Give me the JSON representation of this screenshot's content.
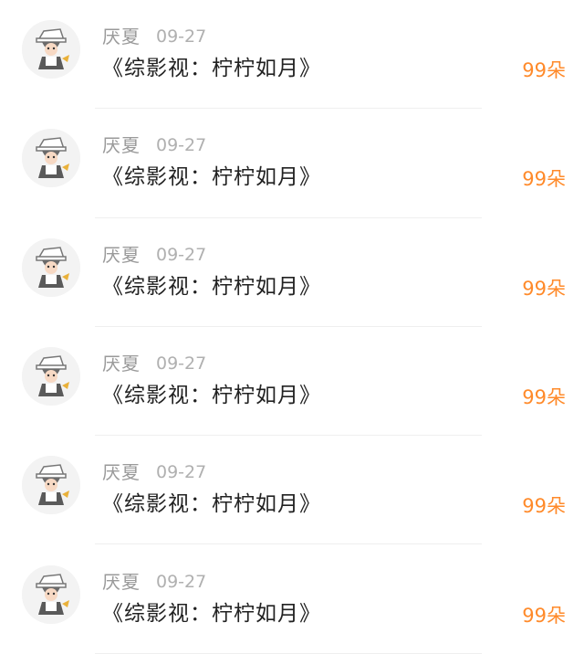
{
  "items": [
    {
      "user": "厌夏",
      "date": "09-27",
      "title": "《综影视：柠柠如月》",
      "count": "99朵",
      "avatar_icon": "avatar-cartoon-icon"
    },
    {
      "user": "厌夏",
      "date": "09-27",
      "title": "《综影视：柠柠如月》",
      "count": "99朵",
      "avatar_icon": "avatar-cartoon-icon"
    },
    {
      "user": "厌夏",
      "date": "09-27",
      "title": "《综影视：柠柠如月》",
      "count": "99朵",
      "avatar_icon": "avatar-cartoon-icon"
    },
    {
      "user": "厌夏",
      "date": "09-27",
      "title": "《综影视：柠柠如月》",
      "count": "99朵",
      "avatar_icon": "avatar-cartoon-icon"
    },
    {
      "user": "厌夏",
      "date": "09-27",
      "title": "《综影视：柠柠如月》",
      "count": "99朵",
      "avatar_icon": "avatar-cartoon-icon"
    },
    {
      "user": "厌夏",
      "date": "09-27",
      "title": "《综影视：柠柠如月》",
      "count": "99朵",
      "avatar_icon": "avatar-cartoon-icon"
    }
  ],
  "colors": {
    "count_accent": "#ff8a2a",
    "name": "#9a9a9a",
    "date": "#b0b0b0",
    "title": "#222222"
  }
}
